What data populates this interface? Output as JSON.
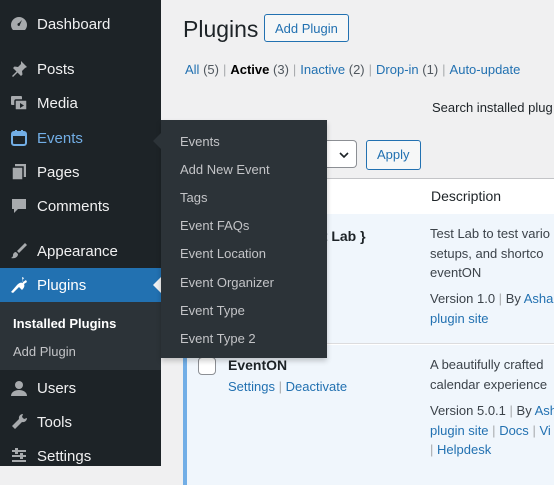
{
  "sidebar": {
    "items": [
      {
        "label": "Dashboard",
        "icon": "dashboard-icon"
      },
      {
        "label": "Posts",
        "icon": "pin-icon"
      },
      {
        "label": "Media",
        "icon": "media-icon"
      },
      {
        "label": "Events",
        "icon": "calendar-icon"
      },
      {
        "label": "Pages",
        "icon": "pages-icon"
      },
      {
        "label": "Comments",
        "icon": "comment-icon"
      },
      {
        "label": "Appearance",
        "icon": "brush-icon"
      },
      {
        "label": "Plugins",
        "icon": "plugin-icon"
      },
      {
        "label": "Users",
        "icon": "user-icon"
      },
      {
        "label": "Tools",
        "icon": "wrench-icon"
      },
      {
        "label": "Settings",
        "icon": "settings-icon"
      }
    ],
    "plugins_submenu": [
      "Installed Plugins",
      "Add Plugin"
    ]
  },
  "events_flyout": [
    "Events",
    "Add New Event",
    "Tags",
    "Event FAQs",
    "Event Location",
    "Event Organizer",
    "Event Type",
    "Event Type 2"
  ],
  "header": {
    "title": "Plugins",
    "add_button": "Add Plugin"
  },
  "filters": [
    {
      "label": "All",
      "count": "(5)"
    },
    {
      "label": "Active",
      "count": "(3)"
    },
    {
      "label": "Inactive",
      "count": "(2)"
    },
    {
      "label": "Drop-in",
      "count": "(1)"
    },
    {
      "label": "Auto-update",
      "count": ""
    }
  ],
  "search_label": "Search installed plug",
  "apply_label": "Apply",
  "table": {
    "description_header": "Description",
    "rows": [
      {
        "title": "st Lab }",
        "desc_lines": [
          "Test Lab to test vario",
          "setups, and shortco",
          "eventON"
        ],
        "version": "Version 1.0",
        "by": "By",
        "author": "Asha",
        "site": "plugin site"
      },
      {
        "title": "EventON",
        "settings": "Settings",
        "deactivate": "Deactivate",
        "desc_lines": [
          "A beautifully crafted",
          "calendar experience"
        ],
        "version": "Version 5.0.1",
        "by": "By",
        "author": "Ash",
        "site": "plugin site",
        "docs": "Docs",
        "extra": "Vi",
        "helpdesk": "Helpdesk"
      }
    ]
  },
  "colors": {
    "sidebar": "#1d2327",
    "accent": "#2271b1",
    "active_blue": "#72aee6",
    "flyout": "#2c3338"
  }
}
